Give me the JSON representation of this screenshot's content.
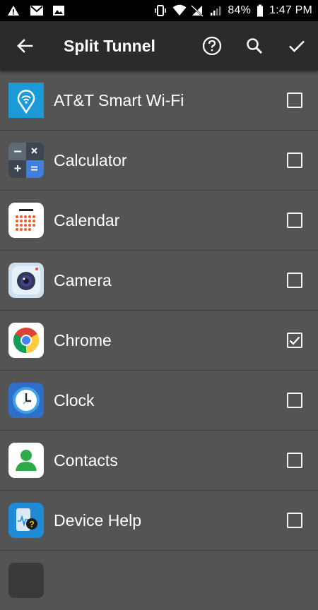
{
  "status_bar": {
    "battery": "84%",
    "time": "1:47 PM",
    "left_icons": [
      "alert-icon",
      "gmail-icon",
      "image-icon"
    ],
    "right_icons": [
      "vibrate-icon",
      "wifi-icon",
      "do-not-disturb-icon",
      "signal-icon",
      "battery-icon"
    ]
  },
  "app_bar": {
    "title": "Split Tunnel",
    "back_icon": "arrow-left-icon",
    "help_icon": "help-circle-icon",
    "search_icon": "search-icon",
    "confirm_icon": "check-icon"
  },
  "apps": [
    {
      "label": "AT&T Smart Wi-Fi",
      "icon": "att-wifi-icon",
      "checked": false
    },
    {
      "label": "Calculator",
      "icon": "calculator-icon",
      "checked": false
    },
    {
      "label": "Calendar",
      "icon": "calendar-icon",
      "checked": false
    },
    {
      "label": "Camera",
      "icon": "camera-icon",
      "checked": false
    },
    {
      "label": "Chrome",
      "icon": "chrome-icon",
      "checked": true
    },
    {
      "label": "Clock",
      "icon": "clock-icon",
      "checked": false
    },
    {
      "label": "Contacts",
      "icon": "contacts-icon",
      "checked": false
    },
    {
      "label": "Device Help",
      "icon": "device-help-icon",
      "checked": false
    }
  ],
  "colors": {
    "background": "#545454",
    "app_bar": "#2b2b2b",
    "status_bar": "#000000",
    "text": "#ffffff"
  }
}
